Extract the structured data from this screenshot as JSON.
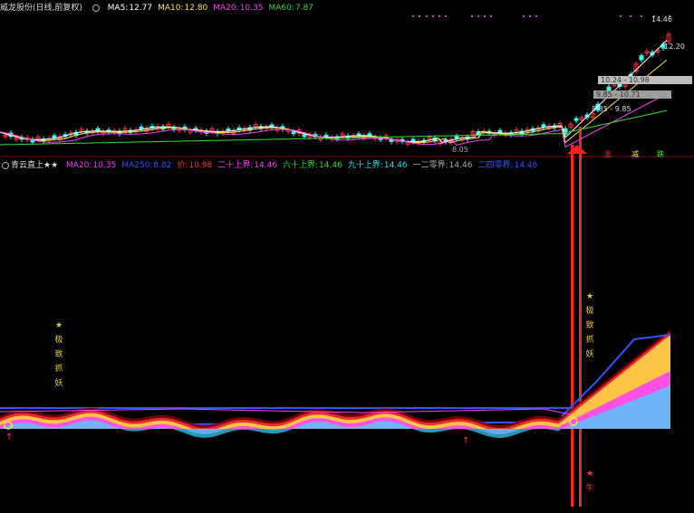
{
  "stock": {
    "name": "威龙股份",
    "mode": "(日线,前复权)"
  },
  "ma": [
    {
      "label": "MA5:",
      "value": "12.77",
      "color": "#ffffff"
    },
    {
      "label": "MA10:",
      "value": "12.80",
      "color": "#ffe14d"
    },
    {
      "label": "MA20:",
      "value": "10.35",
      "color": "#ff3cff"
    },
    {
      "label": "MA60:",
      "value": "7.87",
      "color": "#33dd33"
    }
  ],
  "price_labels": {
    "high": "14.46",
    "p1": "12.20",
    "box1": "10.24 - 10.98",
    "box2": "9.85 - 10.71",
    "box3": "8.85 - 9.85",
    "low": "8.05"
  },
  "signals": {
    "rise": "涨",
    "flat": "减",
    "fall": "跌"
  },
  "indicator": {
    "name": "青云直上★★",
    "items": [
      {
        "label": "MA20:",
        "value": "10.35",
        "color": "#ff3cff"
      },
      {
        "label": "MA250:",
        "value": "8.82",
        "color": "#3355ff"
      },
      {
        "label": "价:",
        "value": "10.98",
        "color": "#ff3333"
      },
      {
        "label": "二十上界:",
        "value": "14.46",
        "color": "#ff3cff"
      },
      {
        "label": "六十上界:",
        "value": "14.46",
        "color": "#33dd33"
      },
      {
        "label": "九十上界:",
        "value": "14.46",
        "color": "#33ddff"
      },
      {
        "label": "一二零界:",
        "value": "14.46",
        "color": "#aaaaaa"
      },
      {
        "label": "二四零界:",
        "value": "14.46",
        "color": "#3355ff"
      }
    ]
  },
  "annotations": {
    "left_star": "★",
    "left_chars": [
      "极",
      "致",
      "抓",
      "妖"
    ],
    "right_star": "★",
    "right_chars": [
      "极",
      "致",
      "抓",
      "妖"
    ],
    "bottom_star": "★",
    "bottom_char": "牛"
  },
  "colors": {
    "up": "#ff3333",
    "down": "#33ffff",
    "axis": "#8b0000"
  }
}
